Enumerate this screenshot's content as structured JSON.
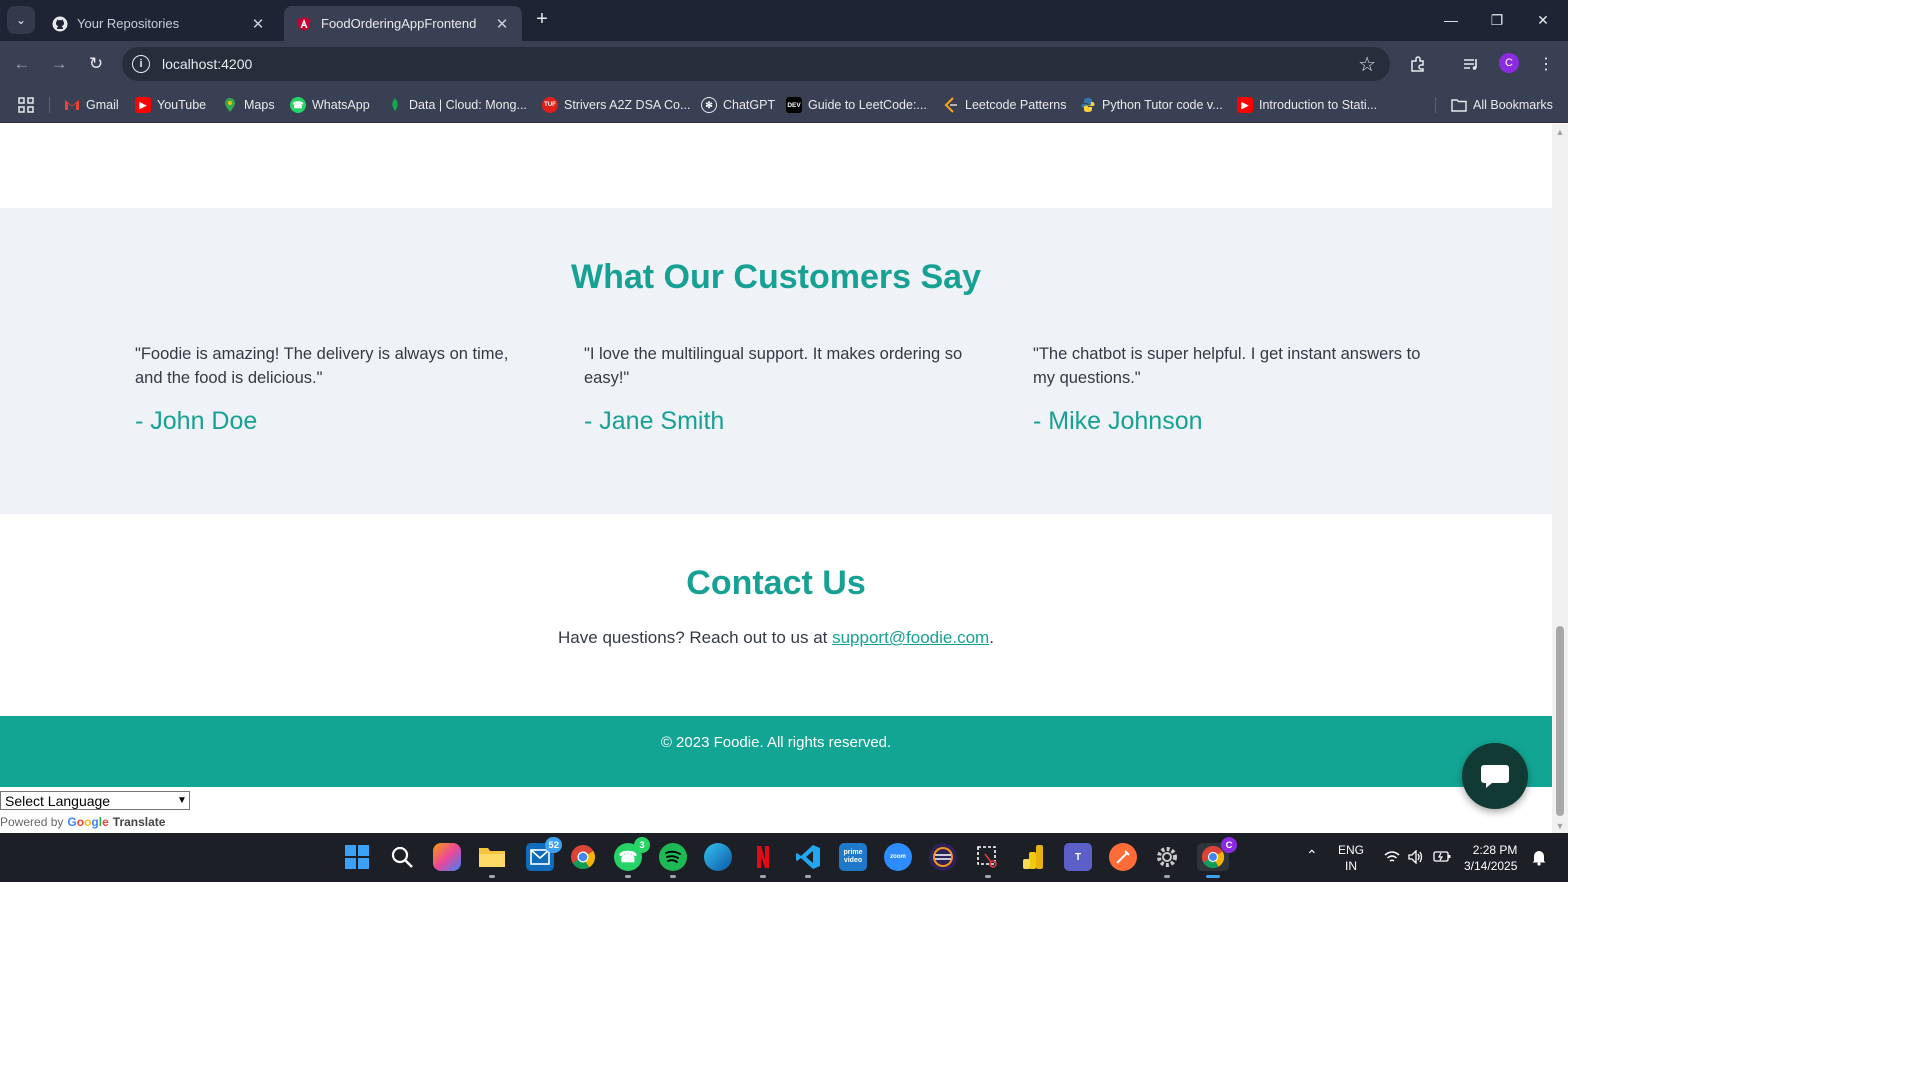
{
  "browser": {
    "tabs": [
      {
        "title": "Your Repositories",
        "icon": "github-icon",
        "active": false
      },
      {
        "title": "FoodOrderingAppFrontend",
        "icon": "angular-icon",
        "active": true
      }
    ],
    "url": "localhost:4200",
    "profile_initial": "C",
    "bookmarks": [
      {
        "label": "Gmail",
        "icon": "gmail-icon"
      },
      {
        "label": "YouTube",
        "icon": "youtube-icon"
      },
      {
        "label": "Maps",
        "icon": "maps-icon"
      },
      {
        "label": "WhatsApp",
        "icon": "whatsapp-icon"
      },
      {
        "label": "Data | Cloud: Mong...",
        "icon": "mongodb-icon"
      },
      {
        "label": "Strivers A2Z DSA Co...",
        "icon": "tuf-icon"
      },
      {
        "label": "ChatGPT",
        "icon": "chatgpt-icon"
      },
      {
        "label": "Guide to LeetCode:...",
        "icon": "dev-icon"
      },
      {
        "label": "Leetcode Patterns",
        "icon": "leetcode-icon"
      },
      {
        "label": "Python Tutor code v...",
        "icon": "python-icon"
      },
      {
        "label": "Introduction to Stati...",
        "icon": "youtube-icon"
      }
    ],
    "all_bookmarks": "All Bookmarks",
    "tuf_text": "TUF",
    "dev_text": "DEV"
  },
  "page": {
    "testimonials": {
      "title": "What Our Customers Say",
      "items": [
        {
          "quote": "\"Foodie is amazing! The delivery is always on time, and the food is delicious.\"",
          "author": "- John Doe"
        },
        {
          "quote": "\"I love the multilingual support. It makes ordering so easy!\"",
          "author": "- Jane Smith"
        },
        {
          "quote": "\"The chatbot is super helpful. I get instant answers to my questions.\"",
          "author": "- Mike Johnson"
        }
      ]
    },
    "contact": {
      "title": "Contact Us",
      "text": "Have questions? Reach out to us at ",
      "email": "support@foodie.com",
      "suffix": "."
    },
    "footer": "© 2023 Foodie. All rights reserved.",
    "translate": {
      "select_value": "Select Language",
      "powered_by": "Powered by",
      "google": "Google",
      "translate": "Translate"
    }
  },
  "taskbar": {
    "apps": [
      {
        "name": "start-icon"
      },
      {
        "name": "search-icon"
      },
      {
        "name": "copilot-icon"
      },
      {
        "name": "file-explorer-icon"
      },
      {
        "name": "outlook-icon",
        "badge": "52"
      },
      {
        "name": "chrome-icon"
      },
      {
        "name": "whatsapp-icon",
        "badge": "3"
      },
      {
        "name": "spotify-icon"
      },
      {
        "name": "edge-icon"
      },
      {
        "name": "netflix-icon"
      },
      {
        "name": "vscode-icon"
      },
      {
        "name": "prime-video-icon"
      },
      {
        "name": "zoom-icon"
      },
      {
        "name": "eclipse-icon"
      },
      {
        "name": "snipping-tool-icon"
      },
      {
        "name": "power-bi-icon"
      },
      {
        "name": "teams-icon"
      },
      {
        "name": "postman-icon"
      },
      {
        "name": "settings-icon"
      },
      {
        "name": "chrome-profile-icon"
      }
    ],
    "lang_top": "ENG",
    "lang_bottom": "IN",
    "time": "2:28 PM",
    "date": "3/14/2025"
  },
  "colors": {
    "accent": "#17a094",
    "footer_bg": "#13a593",
    "section_bg": "#eff2f6",
    "chat_fab": "#123a35"
  }
}
